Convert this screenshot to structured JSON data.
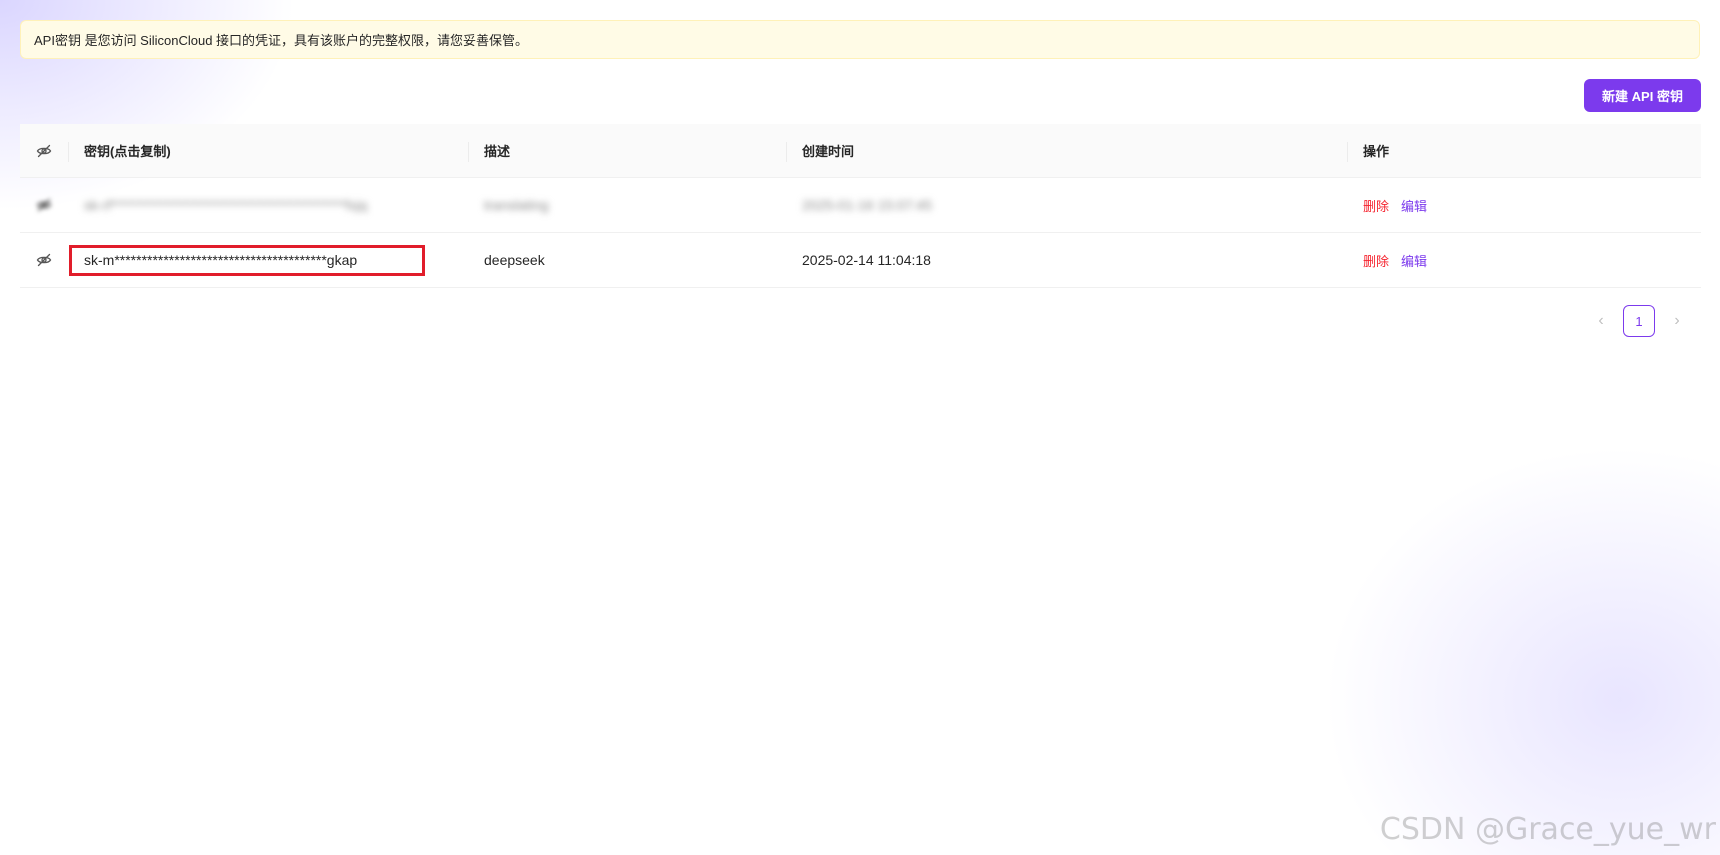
{
  "alert": {
    "text": "API密钥 是您访问 SiliconCloud 接口的凭证，具有该账户的完整权限，请您妥善保管。"
  },
  "actions": {
    "new_key_label": "新建 API 密钥"
  },
  "table": {
    "columns": {
      "key": "密钥(点击复制)",
      "description": "描述",
      "created": "创建时间",
      "operations": "操作"
    },
    "rows": [
      {
        "key": "sk-rf*******************************************fxjq",
        "description": "translating",
        "created": "2025-01-16 15:07:45",
        "delete_label": "删除",
        "edit_label": "编辑"
      },
      {
        "key": "sk-m***************************************gkap",
        "description": "deepseek",
        "created": "2025-02-14 11:04:18",
        "delete_label": "删除",
        "edit_label": "编辑"
      }
    ]
  },
  "pagination": {
    "prev": "‹",
    "current": "1",
    "next": "›"
  },
  "watermark": "CSDN @Grace_yue_wr",
  "colors": {
    "accent": "#7c3aed",
    "danger": "#f5222d",
    "highlight_box": "#e11d2a",
    "alert_bg": "#fffbe6"
  },
  "icons": {
    "column_toggle": "eye-off-icon",
    "row_toggle": "eye-off-icon"
  }
}
